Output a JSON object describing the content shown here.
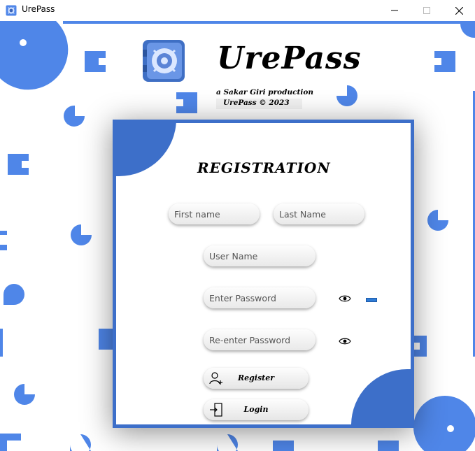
{
  "window": {
    "title": "UrePass",
    "minimize_glyph": "—",
    "maximize_glyph": "☐",
    "close_glyph": "✕"
  },
  "branding": {
    "app_name": "UrePass",
    "credit_line": "a Sakar Giri production",
    "copyright_line": "UrePass © 2023",
    "logo_icon": "vault-icon"
  },
  "registration": {
    "title": "REGISTRATION",
    "first_name_placeholder": "First name",
    "last_name_placeholder": "Last Name",
    "username_placeholder": "User Name",
    "password_placeholder": "Enter Password",
    "reenter_password_placeholder": "Re-enter Password",
    "register_label": "Register",
    "login_label": "Login",
    "icons": {
      "show_password": "eye-icon",
      "register": "add-user-icon",
      "login": "login-door-icon"
    }
  },
  "colors": {
    "accent": "#4f86e8",
    "frame": "#3d6fc9",
    "password_strength": "#2f7cd6"
  }
}
